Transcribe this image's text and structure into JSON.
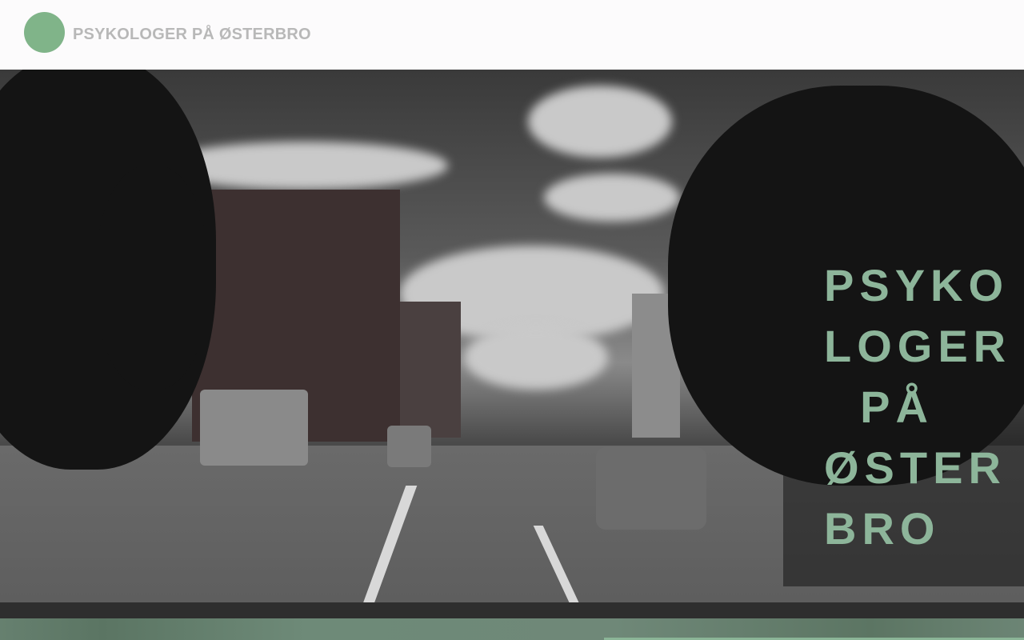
{
  "header": {
    "site_title": "PSYKOLOGER PÅ ØSTERBRO",
    "logo_color": "#80b489"
  },
  "hero": {
    "title": "PSYKOLOGER\n  PÅ\nØSTERBRO",
    "title_color": "#8db59a",
    "image": "black-and-white street photo of Østerbro"
  }
}
